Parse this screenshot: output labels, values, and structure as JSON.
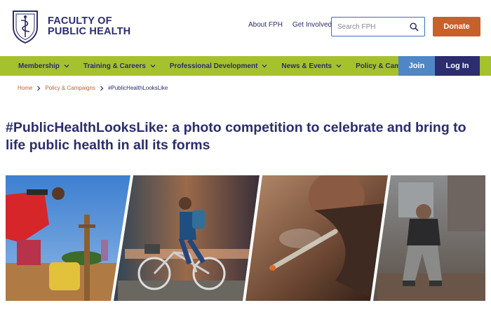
{
  "brand": {
    "line1": "FACULTY OF",
    "line2": "PUBLIC HEALTH"
  },
  "utility_links": [
    "About FPH",
    "Get Involved"
  ],
  "search": {
    "placeholder": "Search FPH"
  },
  "donate_label": "Donate",
  "nav": {
    "items": [
      {
        "label": "Membership"
      },
      {
        "label": "Training & Careers"
      },
      {
        "label": "Professional Development"
      },
      {
        "label": "News & Events"
      },
      {
        "label": "Policy & Campaigns"
      }
    ],
    "join_label": "Join",
    "login_label": "Log In"
  },
  "breadcrumb": {
    "home": "Home",
    "section": "Policy & Campaigns",
    "current": "#PublicHealthLooksLike"
  },
  "page_title": "#PublicHealthLooksLike: a photo competition to celebrate and bring to life public health in all its forms",
  "colors": {
    "navy": "#2b2d6e",
    "nav_green": "#a6c12e",
    "donate_orange": "#c8602a",
    "join_blue": "#4f86c6"
  },
  "icons": [
    "crest-logo-icon",
    "search-icon",
    "chevron-down-icon",
    "chevron-right-icon"
  ]
}
